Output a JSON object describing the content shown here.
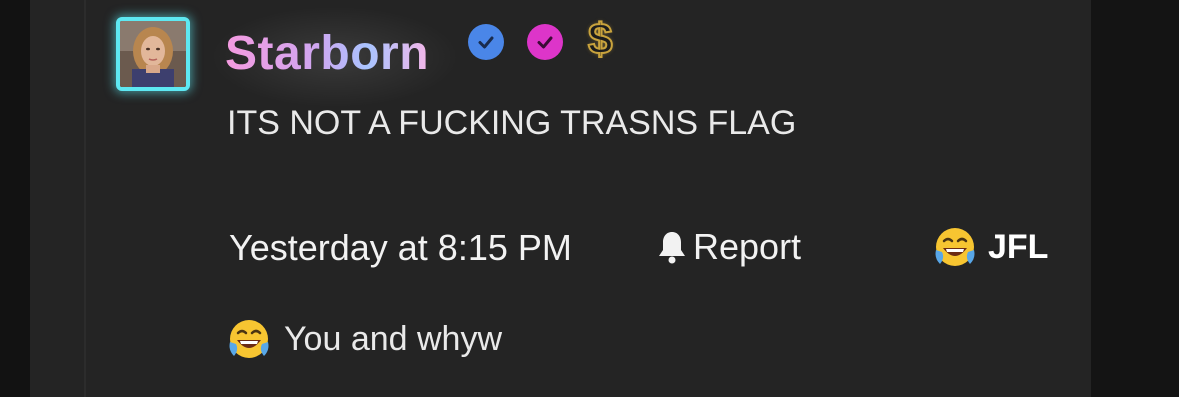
{
  "post": {
    "author": "Starborn",
    "badges": [
      {
        "name": "verified-blue",
        "color": "#4a86e8"
      },
      {
        "name": "verified-pink",
        "color": "#dd35c9"
      },
      {
        "name": "dollar-gold",
        "color": "#c9a33d"
      }
    ],
    "dollar_symbol": "$",
    "message": "ITS NOT A FUCKING TRASNS FLAG",
    "timestamp": "Yesterday at 8:15 PM",
    "report_label": "Report",
    "reaction": {
      "icon": "laugh-cry-emoji",
      "label": "JFL"
    }
  },
  "reply": {
    "icon": "laugh-cry-emoji",
    "text": "You and whyw"
  },
  "colors": {
    "background": "#242424",
    "avatar_border": "#5ee8f2",
    "text": "#e9e9e9"
  }
}
